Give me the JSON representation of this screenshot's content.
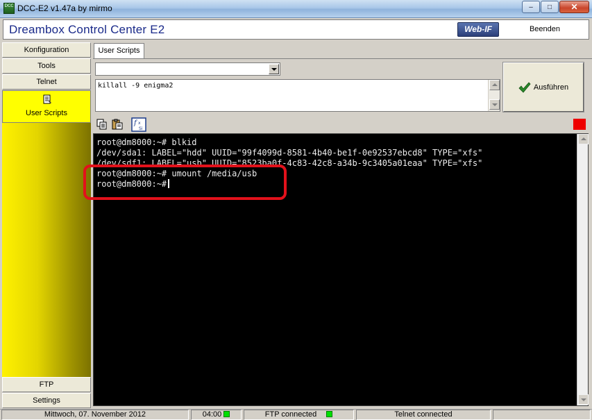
{
  "window": {
    "title": "DCC-E2 v1.47a by mirmo",
    "icon_text": "DCC",
    "min_glyph": "–",
    "max_glyph": "□",
    "close_glyph": "✕"
  },
  "header": {
    "app_title": "Dreambox Control Center E2",
    "webif_label": "Web-IF",
    "quit_label": "Beenden"
  },
  "nav": {
    "items": [
      {
        "label": "Konfiguration"
      },
      {
        "label": "Tools"
      },
      {
        "label": "Telnet"
      },
      {
        "label": "User Scripts",
        "active": true
      },
      {
        "label": "FTP"
      },
      {
        "label": "Settings"
      }
    ],
    "active_color": "#ffff00"
  },
  "user_scripts": {
    "tab_label": "User Scripts",
    "combo_value": "",
    "script_text": "killall -9 enigma2",
    "run_label": "Ausführen"
  },
  "toolbar": {
    "icons": [
      "copy-icon",
      "paste-icon",
      "script-function-icon"
    ],
    "indicator_color": "#ee0000"
  },
  "terminal": {
    "lines": [
      "root@dm8000:~# blkid",
      "/dev/sda1: LABEL=\"hdd\" UUID=\"99f4099d-8581-4b40-be1f-0e92537ebcd8\" TYPE=\"xfs\"",
      "/dev/sdf1: LABEL=\"usb\" UUID=\"8523ba0f-4c83-42c8-a34b-9c3405a01eaa\" TYPE=\"xfs\"",
      "root@dm8000:~# umount /media/usb",
      "root@dm8000:~#"
    ],
    "highlight_color": "#e2111b"
  },
  "status": {
    "date": "Mittwoch, 07. November 2012",
    "time": "04:00",
    "ftp": "FTP connected",
    "telnet": "Telnet connected",
    "led_color": "#00e000"
  }
}
